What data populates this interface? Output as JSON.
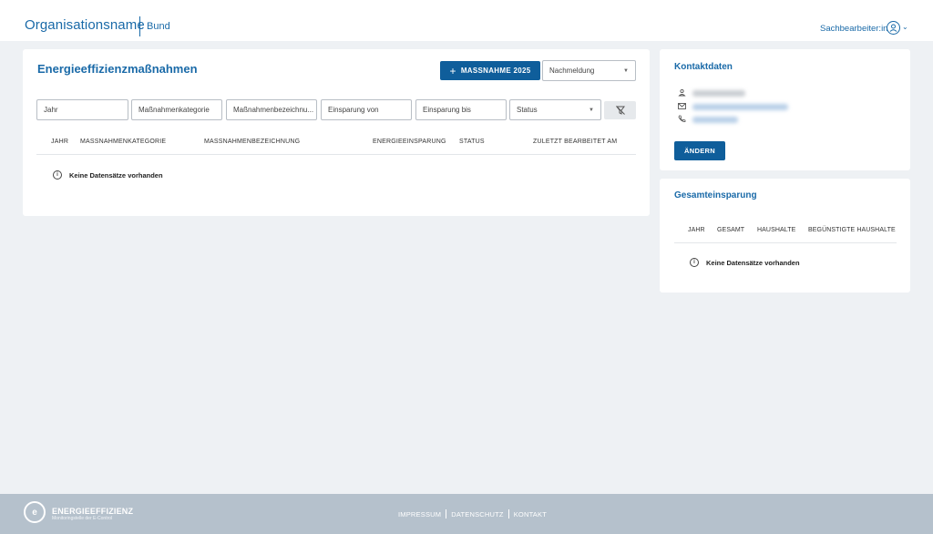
{
  "header": {
    "org_name": "Organisationsname",
    "org_level": "Bund",
    "user_label": "Sachbearbeiter:in",
    "user_icon": "user-circle-icon"
  },
  "main": {
    "title": "Energieeffizienzmaßnahmen",
    "add_button": "MASSNAHME 2025",
    "report_select": "Nachmeldung",
    "filters": {
      "jahr": "Jahr",
      "kategorie": "Maßnahmenkategorie",
      "bezeichnung": "Maßnahmenbezeichnu...",
      "einsparung_von": "Einsparung von",
      "einsparung_bis": "Einsparung bis",
      "status": "Status"
    },
    "columns": [
      "JAHR",
      "MASSNAHMENKATEGORIE",
      "MASSNAHMENBEZEICHNUNG",
      "ENERGIEEINSPARUNG",
      "STATUS",
      "ZULETZT BEARBEITET AM"
    ],
    "empty": "Keine Datensätze vorhanden"
  },
  "contact": {
    "title": "Kontaktdaten",
    "change_button": "ÄNDERN"
  },
  "total": {
    "title": "Gesamteinsparung",
    "columns": [
      "JAHR",
      "GESAMT",
      "HAUSHALTE",
      "BEGÜNSTIGTE HAUSHALTE"
    ],
    "empty": "Keine Datensätze vorhanden"
  },
  "footer": {
    "logo_title": "ENERGIEEFFIZIENZ",
    "logo_sub": "Monitoringstelle der E-Control",
    "links": [
      "IMPRESSUM",
      "DATENSCHUTZ",
      "KONTAKT"
    ]
  },
  "colors": {
    "brand": "#1a6aa8",
    "button": "#0f5e9b",
    "footer": "#b5c1cc"
  }
}
